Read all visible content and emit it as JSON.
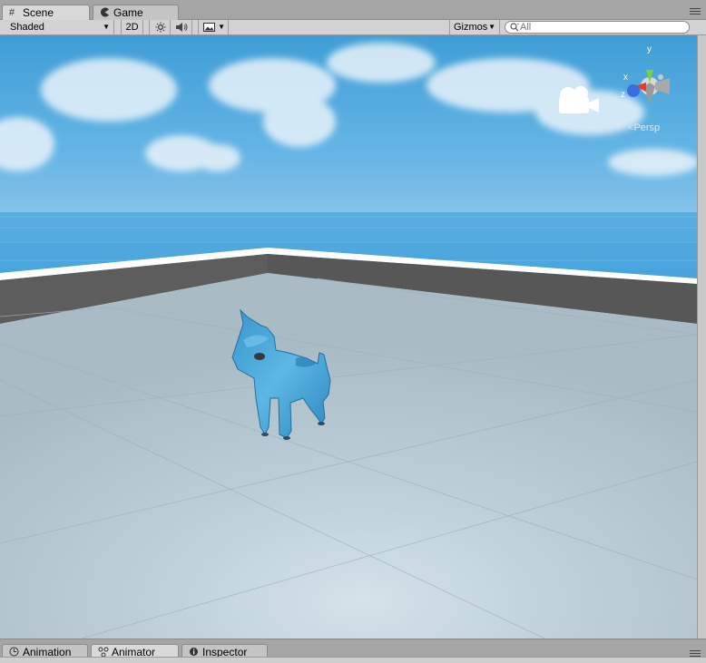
{
  "top_tabs": [
    {
      "label": "Scene",
      "icon": "grid-icon",
      "active": true
    },
    {
      "label": "Game",
      "icon": "pacman-icon",
      "active": false
    }
  ],
  "toolbar": {
    "shading_mode": "Shaded",
    "mode_2d": "2D",
    "gizmos_label": "Gizmos",
    "search_placeholder": "All"
  },
  "scene": {
    "projection_label": "Persp",
    "axis_x": "x",
    "axis_y": "y",
    "axis_z": "z",
    "colors": {
      "sky_top": "#3f9ed6",
      "sky_bottom": "#86c3ea",
      "floor": "#b8c9d2",
      "wall": "#5a5a5a",
      "model": "#4aa6d6"
    }
  },
  "bottom_tabs": [
    {
      "label": "Animation",
      "icon": "clock-icon",
      "active": false
    },
    {
      "label": "Animator",
      "icon": "nodes-icon",
      "active": true
    },
    {
      "label": "Inspector",
      "icon": "info-icon",
      "active": false
    }
  ]
}
